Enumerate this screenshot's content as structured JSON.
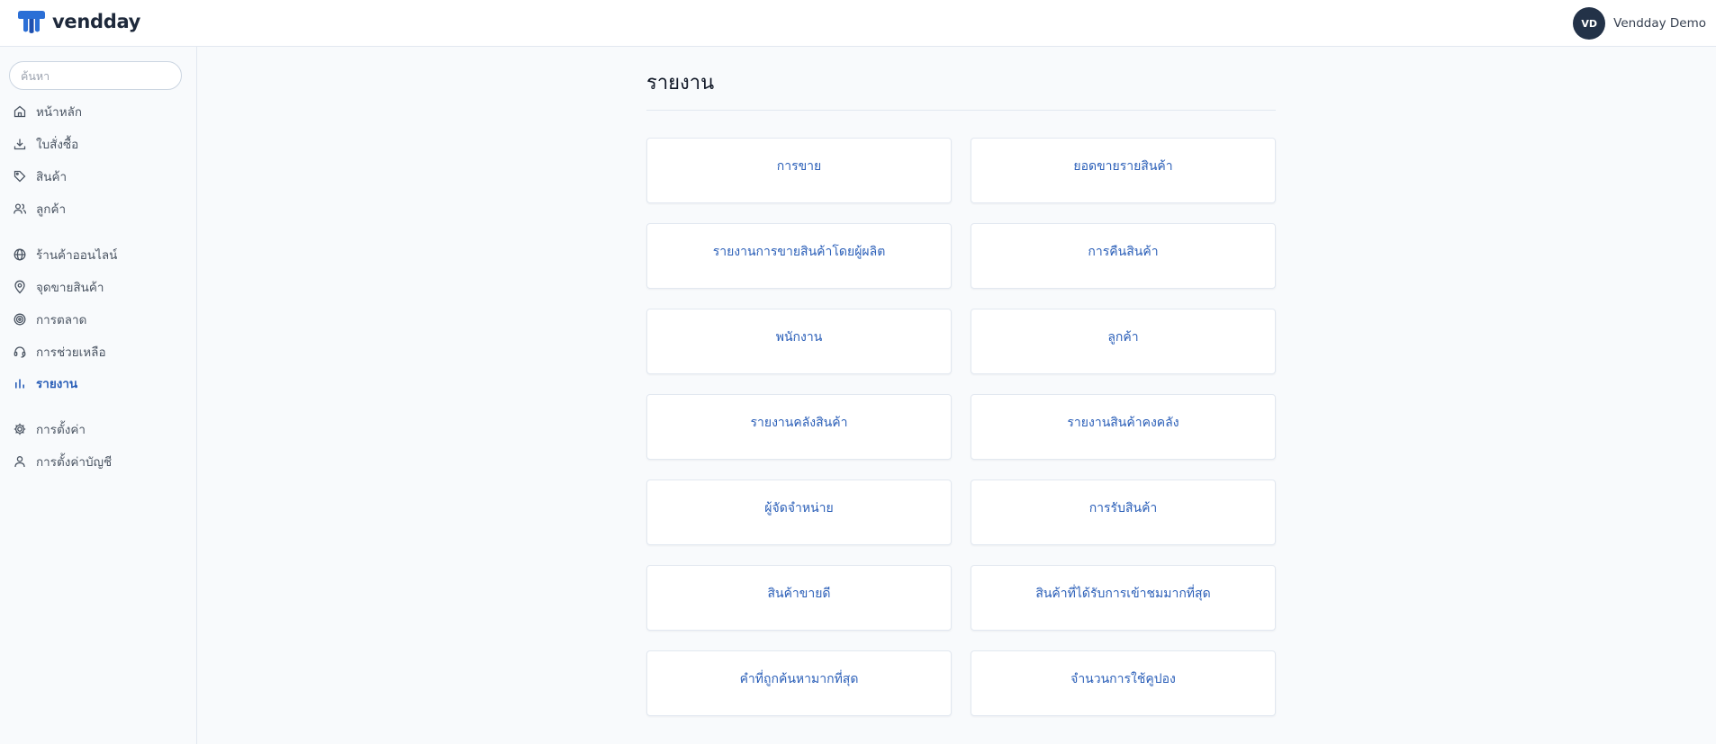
{
  "brand": {
    "name": "vendday",
    "accent": "#2b6fd6"
  },
  "user": {
    "initials": "VD",
    "name": "Vendday Demo",
    "avatar_color": "#233248"
  },
  "search": {
    "placeholder": "ค้นหา"
  },
  "sidebar": {
    "items": [
      {
        "label": "หน้าหลัก",
        "icon": "home-icon"
      },
      {
        "label": "ใบสั่งซื้อ",
        "icon": "download-icon"
      },
      {
        "label": "สินค้า",
        "icon": "tag-icon"
      },
      {
        "label": "ลูกค้า",
        "icon": "users-icon"
      },
      {
        "label": "ร้านค้าออนไลน์",
        "icon": "globe-icon"
      },
      {
        "label": "จุดขายสินค้า",
        "icon": "map-pin-icon"
      },
      {
        "label": "การตลาด",
        "icon": "target-icon"
      },
      {
        "label": "การช่วยเหลือ",
        "icon": "headset-icon"
      },
      {
        "label": "รายงาน",
        "icon": "bar-chart-icon",
        "active": true
      },
      {
        "label": "การตั้งค่า",
        "icon": "gear-icon"
      },
      {
        "label": "การตั้งค่าบัญชี",
        "icon": "user-icon"
      }
    ]
  },
  "page": {
    "title": "รายงาน"
  },
  "reports": [
    "การขาย",
    "ยอดขายรายสินค้า",
    "รายงานการขายสินค้าโดยผู้ผลิต",
    "การคืนสินค้า",
    "พนักงาน",
    "ลูกค้า",
    "รายงานคลังสินค้า",
    "รายงานสินค้าคงคลัง",
    "ผู้จัดจำหน่าย",
    "การรับสินค้า",
    "สินค้าขายดี",
    "สินค้าที่ได้รับการเข้าชมมากที่สุด",
    "คำที่ถูกค้นหามากที่สุด",
    "จำนวนการใช้คูปอง"
  ],
  "colors": {
    "link": "#2b5fb8",
    "border": "#e2e8f0",
    "background": "#f8fafc"
  }
}
